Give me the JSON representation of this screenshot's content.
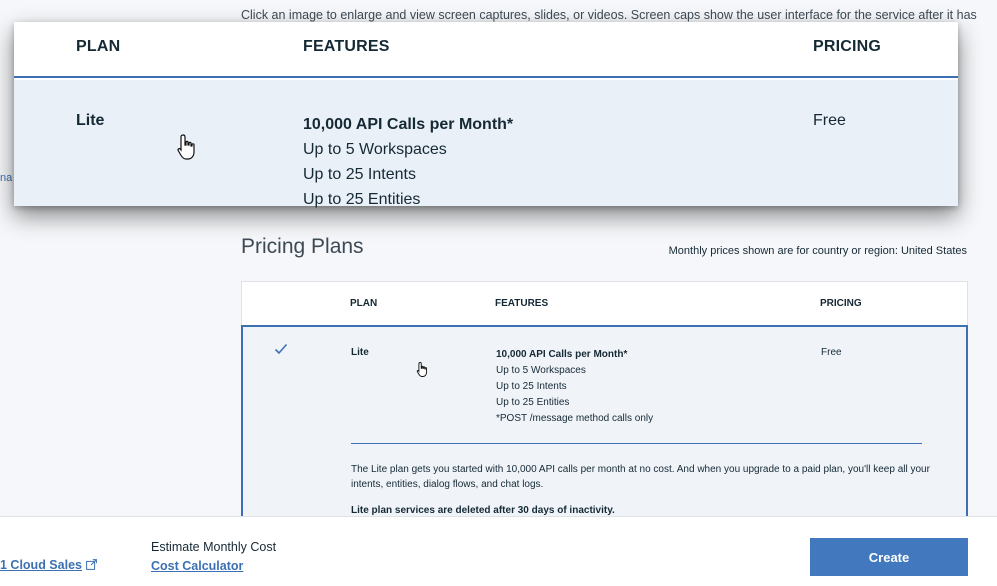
{
  "caption": "Click an image to enlarge and view screen captures, slides, or videos. Screen caps show the user interface for the service after it has",
  "left_edge_text": "na",
  "zoom": {
    "headers": {
      "plan": "PLAN",
      "features": "FEATURES",
      "pricing": "PRICING"
    },
    "plan": "Lite",
    "features": [
      "10,000 API Calls per Month*",
      "Up to 5 Workspaces",
      "Up to 25 Intents",
      "Up to 25 Entities"
    ],
    "pricing": "Free"
  },
  "section": {
    "title": "Pricing Plans",
    "region_note": "Monthly prices shown are for country or region: United States"
  },
  "table": {
    "headers": {
      "plan": "PLAN",
      "features": "FEATURES",
      "pricing": "PRICING"
    },
    "row": {
      "plan": "Lite",
      "features": [
        "10,000 API Calls per Month*",
        "Up to 5 Workspaces",
        "Up to 25 Intents",
        "Up to 25 Entities",
        "*POST /message method calls only"
      ],
      "pricing": "Free",
      "description": "The Lite plan gets you started with 10,000 API calls per month at no cost. And when you upgrade to a paid plan, you'll keep all your intents, entities, dialog flows, and chat logs.",
      "warning": "Lite plan services are deleted after 30 days of inactivity."
    }
  },
  "footer": {
    "contact_link": "1 Cloud Sales",
    "estimate_label": "Estimate Monthly Cost",
    "calculator_link": "Cost Calculator",
    "create_label": "Create"
  },
  "colors": {
    "accent": "#3d70b2",
    "button": "#4178be",
    "selected_row_bg": "#f0f4f9"
  },
  "icons": [
    "hand-cursor-icon",
    "checkmark-icon",
    "external-link-icon"
  ]
}
